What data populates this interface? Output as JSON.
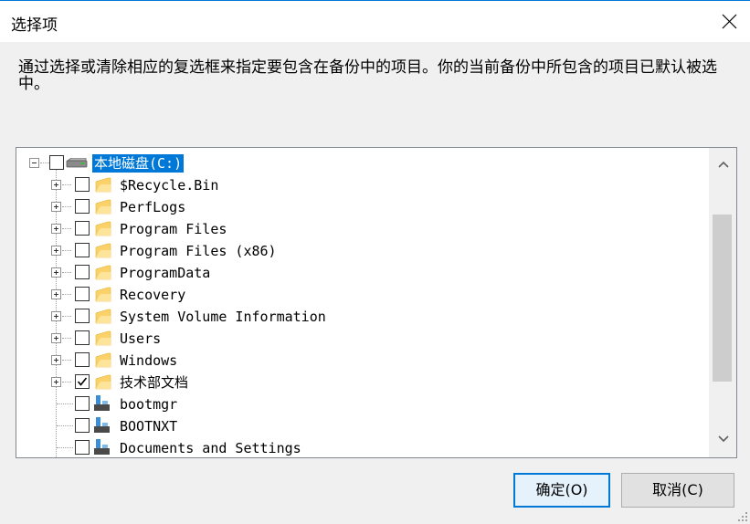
{
  "window": {
    "title": "选择项"
  },
  "description": "通过选择或清除相应的复选框来指定要包含在备份中的项目。你的当前备份中所包含的项目已默认被选中。",
  "tree": {
    "root": {
      "label": "本地磁盘(C:)",
      "checked": false,
      "expanded": true,
      "icon": "drive-icon"
    },
    "items": [
      {
        "label": "$Recycle.Bin",
        "type": "folder",
        "checked": false
      },
      {
        "label": "PerfLogs",
        "type": "folder",
        "checked": false
      },
      {
        "label": "Program Files",
        "type": "folder",
        "checked": false
      },
      {
        "label": "Program Files (x86)",
        "type": "folder",
        "checked": false
      },
      {
        "label": "ProgramData",
        "type": "folder",
        "checked": false
      },
      {
        "label": "Recovery",
        "type": "folder",
        "checked": false
      },
      {
        "label": "System Volume Information",
        "type": "folder",
        "checked": false
      },
      {
        "label": "Users",
        "type": "folder",
        "checked": false
      },
      {
        "label": "Windows",
        "type": "folder",
        "checked": false
      },
      {
        "label": "技术部文档",
        "type": "folder",
        "checked": true
      },
      {
        "label": "bootmgr",
        "type": "file",
        "checked": false
      },
      {
        "label": "BOOTNXT",
        "type": "file",
        "checked": false
      },
      {
        "label": "Documents and Settings",
        "type": "file",
        "checked": false
      }
    ]
  },
  "buttons": {
    "ok": "确定(O)",
    "cancel": "取消(C)"
  },
  "colors": {
    "accent": "#0078d7",
    "folder": "#fbd26a",
    "file": "#3a8fd6"
  }
}
